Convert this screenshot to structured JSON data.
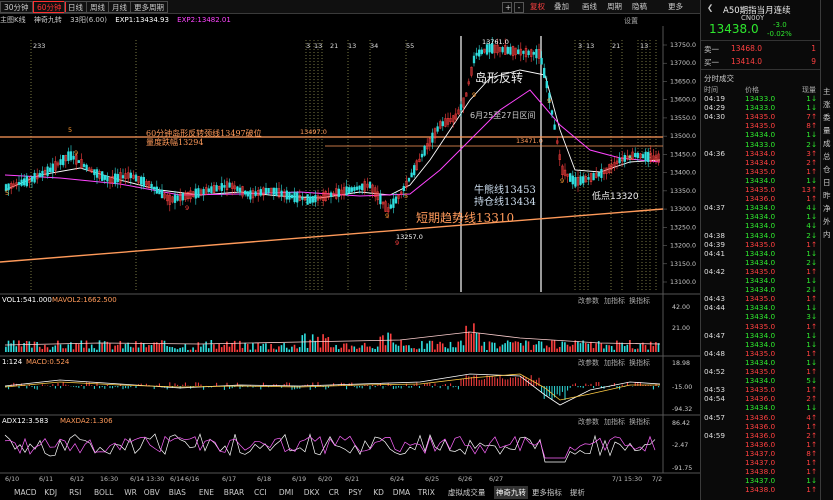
{
  "toolbar": {
    "periods": [
      "30分钟",
      "60分钟",
      "日线",
      "周线",
      "月线",
      "更多周期"
    ],
    "selected_period": "60分钟",
    "right_buttons": [
      "+",
      "-",
      "叠加",
      "画线",
      "周期",
      "隐稿"
    ],
    "red_button": "复权",
    "more_label": "更多",
    "setting_label": "设置"
  },
  "indicator_line": {
    "main": "主图K线",
    "params": "神奇九转",
    "val1": "33阳(6.00)",
    "ema1": "EXP1:13434.93",
    "ema2": "EXP2:13482.01"
  },
  "annotations": {
    "island_title": "岛形反转",
    "island_range": "6月25至27日区间",
    "break_line": "60分钟岛形反转颈线13497破位",
    "drop": "量度跌幅13294",
    "bull_line": "牛熊线13453",
    "hold_line": "持仓线13434",
    "short_trend": "短期趋势线13310",
    "low_point": "低点13320",
    "price_13761": "13761.0",
    "price_13497": "13497.0",
    "price_13471": "13471.0",
    "price_13257": "13257.0"
  },
  "axis": {
    "main_ticks": [
      "13750.0",
      "13700.0",
      "13650.0",
      "13600.0",
      "13550.0",
      "13500.0",
      "13450.0",
      "13400.0",
      "13350.0",
      "13300.0",
      "13250.0",
      "13200.0",
      "13150.0",
      "13100.0"
    ],
    "vol_ticks": [
      "42.00",
      "21.00"
    ],
    "macd_ticks": [
      "18.98",
      "-15.00",
      "-94.32"
    ],
    "adx_ticks": [
      "86.42",
      "-2.47",
      "-91.75"
    ],
    "date_ticks": [
      "6/10",
      "6/11",
      "6/12",
      "16:30",
      "6/14 13:30",
      "6/14",
      "6/16",
      "6/17",
      "6/18",
      "6/19",
      "6/20",
      "6/21",
      "6/24",
      "6/25",
      "6/26",
      "6/27",
      "7/1",
      "15:30",
      "7/2"
    ]
  },
  "panels": {
    "vol_label": "VOL1:541.000",
    "vol_ma": "MAVOL2:1662.500",
    "macd_label": "1:124",
    "macd_val": "MACD:0.524",
    "adx_label": "ADX12:3.583",
    "adx_val": "MAXDA2:1.306",
    "controls": [
      "改参数",
      "加指标",
      "换指标"
    ]
  },
  "bottom_tabs": [
    "MACD",
    "KDJ",
    "RSI",
    "BOLL",
    "WR",
    "OBV",
    "BIAS",
    "ENE",
    "BRAR",
    "CCI",
    "DMI",
    "DKX",
    "CR",
    "PSY",
    "KD",
    "DMA",
    "TRIX",
    "虚拟成交量",
    "神奇九转",
    "更多指标",
    "提析"
  ],
  "selected_bottom_tab": "神奇九转",
  "quote": {
    "name": "A50期指当月连续",
    "code": "CN00Y",
    "price": "13438.0",
    "change": "-3.0",
    "pct": "-0.02%",
    "sell_label": "卖一",
    "sell_price": "13468.0",
    "sell_vol": "1",
    "buy_label": "买一",
    "buy_price": "13414.0",
    "buy_vol": "9",
    "section": "分时成交",
    "col_time": "时间",
    "col_price": "价格",
    "col_vol": "现量"
  },
  "trades": [
    {
      "t": "04:19",
      "p": "13433.0",
      "v": "1",
      "d": "dn"
    },
    {
      "t": "04:29",
      "p": "13433.0",
      "v": "1",
      "d": "dn"
    },
    {
      "t": "04:30",
      "p": "13435.0",
      "v": "7",
      "d": "up"
    },
    {
      "t": "",
      "p": "13435.0",
      "v": "8",
      "d": "up"
    },
    {
      "t": "",
      "p": "13434.0",
      "v": "1",
      "d": "dn"
    },
    {
      "t": "",
      "p": "13433.0",
      "v": "2",
      "d": "dn"
    },
    {
      "t": "04:36",
      "p": "13434.0",
      "v": "3",
      "d": "up"
    },
    {
      "t": "",
      "p": "13434.0",
      "v": "2",
      "d": "up"
    },
    {
      "t": "",
      "p": "13435.0",
      "v": "1",
      "d": "up"
    },
    {
      "t": "",
      "p": "13434.0",
      "v": "1",
      "d": "dn"
    },
    {
      "t": "",
      "p": "13435.0",
      "v": "13",
      "d": "up"
    },
    {
      "t": "",
      "p": "13436.0",
      "v": "1",
      "d": "up"
    },
    {
      "t": "04:37",
      "p": "13434.0",
      "v": "4",
      "d": "dn"
    },
    {
      "t": "",
      "p": "13434.0",
      "v": "1",
      "d": "dn"
    },
    {
      "t": "",
      "p": "13434.0",
      "v": "4",
      "d": "dn"
    },
    {
      "t": "04:38",
      "p": "13434.0",
      "v": "2",
      "d": "dn"
    },
    {
      "t": "04:39",
      "p": "13435.0",
      "v": "1",
      "d": "up"
    },
    {
      "t": "04:41",
      "p": "13434.0",
      "v": "1",
      "d": "dn"
    },
    {
      "t": "",
      "p": "13434.0",
      "v": "2",
      "d": "dn"
    },
    {
      "t": "04:42",
      "p": "13435.0",
      "v": "1",
      "d": "up"
    },
    {
      "t": "",
      "p": "13434.0",
      "v": "1",
      "d": "dn"
    },
    {
      "t": "",
      "p": "13434.0",
      "v": "2",
      "d": "dn"
    },
    {
      "t": "04:43",
      "p": "13435.0",
      "v": "1",
      "d": "up"
    },
    {
      "t": "04:44",
      "p": "13434.0",
      "v": "1",
      "d": "dn"
    },
    {
      "t": "",
      "p": "13434.0",
      "v": "3",
      "d": "dn"
    },
    {
      "t": "",
      "p": "13435.0",
      "v": "1",
      "d": "up"
    },
    {
      "t": "04:47",
      "p": "13434.0",
      "v": "1",
      "d": "dn"
    },
    {
      "t": "",
      "p": "13434.0",
      "v": "1",
      "d": "dn"
    },
    {
      "t": "04:48",
      "p": "13435.0",
      "v": "1",
      "d": "up"
    },
    {
      "t": "",
      "p": "13434.0",
      "v": "1",
      "d": "dn"
    },
    {
      "t": "04:52",
      "p": "13435.0",
      "v": "1",
      "d": "up"
    },
    {
      "t": "",
      "p": "13434.0",
      "v": "5",
      "d": "dn"
    },
    {
      "t": "04:53",
      "p": "13435.0",
      "v": "1",
      "d": "up"
    },
    {
      "t": "04:54",
      "p": "13436.0",
      "v": "2",
      "d": "up"
    },
    {
      "t": "",
      "p": "13434.0",
      "v": "1",
      "d": "dn"
    },
    {
      "t": "04:57",
      "p": "13436.0",
      "v": "4",
      "d": "up"
    },
    {
      "t": "",
      "p": "13436.0",
      "v": "1",
      "d": "up"
    },
    {
      "t": "04:59",
      "p": "13436.0",
      "v": "2",
      "d": "up"
    },
    {
      "t": "",
      "p": "13436.0",
      "v": "1",
      "d": "up"
    },
    {
      "t": "",
      "p": "13437.0",
      "v": "8",
      "d": "up"
    },
    {
      "t": "",
      "p": "13437.0",
      "v": "1",
      "d": "up"
    },
    {
      "t": "",
      "p": "13438.0",
      "v": "1",
      "d": "up"
    },
    {
      "t": "",
      "p": "13437.0",
      "v": "1",
      "d": "dn"
    },
    {
      "t": "",
      "p": "13438.0",
      "v": "1",
      "d": "up"
    }
  ],
  "side_strip": [
    "主",
    "涨",
    "委",
    "量",
    "成",
    "总",
    "仓",
    "日",
    "昨",
    "净",
    "外",
    "内"
  ],
  "colors": {
    "up": "#ff4040",
    "down": "#2ee82e",
    "ma1": "#ffffff",
    "ma2": "#ff44ff",
    "trend": "#ff9a5a",
    "neck": "#ff9a5a"
  }
}
